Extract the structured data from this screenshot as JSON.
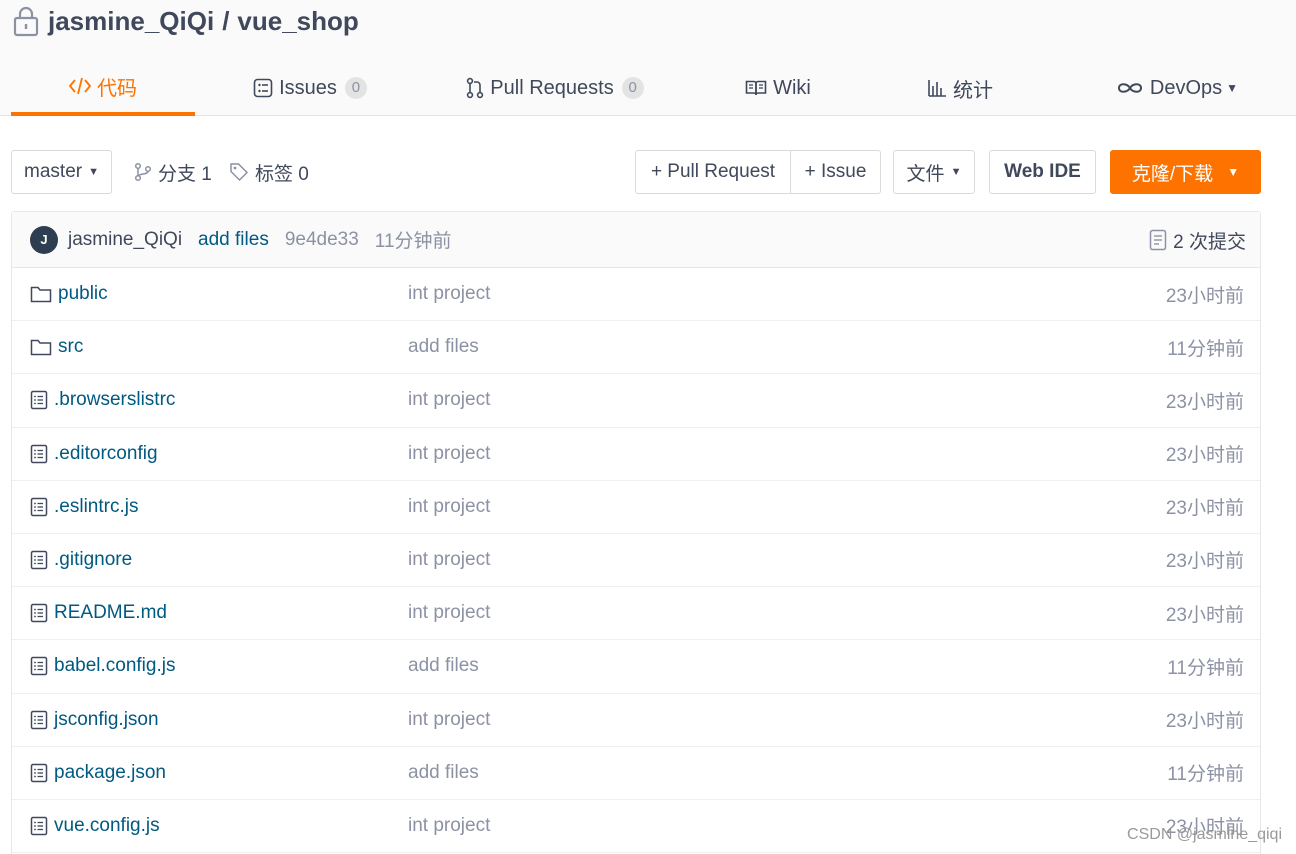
{
  "repo": {
    "owner": "jasmine_QiQi",
    "separator": "/",
    "name": "vue_shop"
  },
  "tabs": [
    {
      "label": "代码",
      "icon": "code-icon",
      "active": true
    },
    {
      "label": "Issues",
      "icon": "issues-icon",
      "count": "0"
    },
    {
      "label": "Pull Requests",
      "icon": "pull-request-icon",
      "count": "0"
    },
    {
      "label": "Wiki",
      "icon": "wiki-icon"
    },
    {
      "label": "统计",
      "icon": "stats-icon"
    },
    {
      "label": "DevOps",
      "icon": "devops-icon",
      "dropdown": true
    }
  ],
  "toolbar": {
    "branch": "master",
    "branches": "分支 1",
    "tags": "标签 0",
    "pull_request": "+ Pull Request",
    "issue": "+ Issue",
    "file": "文件",
    "web_ide": "Web IDE",
    "clone": "克隆/下载"
  },
  "commit": {
    "avatar_letter": "J",
    "author": "jasmine_QiQi",
    "message": "add files",
    "sha": "9e4de33",
    "time": "11分钟前",
    "count_label": "2 次提交"
  },
  "files": [
    {
      "type": "folder",
      "name": "public",
      "message": "int project",
      "time": "23小时前"
    },
    {
      "type": "folder",
      "name": "src",
      "message": "add files",
      "time": "11分钟前"
    },
    {
      "type": "file",
      "name": ".browserslistrc",
      "message": "int project",
      "time": "23小时前"
    },
    {
      "type": "file",
      "name": ".editorconfig",
      "message": "int project",
      "time": "23小时前"
    },
    {
      "type": "file",
      "name": ".eslintrc.js",
      "message": "int project",
      "time": "23小时前"
    },
    {
      "type": "file",
      "name": ".gitignore",
      "message": "int project",
      "time": "23小时前"
    },
    {
      "type": "file",
      "name": "README.md",
      "message": "int project",
      "time": "23小时前"
    },
    {
      "type": "file",
      "name": "babel.config.js",
      "message": "add files",
      "time": "11分钟前"
    },
    {
      "type": "file",
      "name": "jsconfig.json",
      "message": "int project",
      "time": "23小时前"
    },
    {
      "type": "file",
      "name": "package.json",
      "message": "add files",
      "time": "11分钟前"
    },
    {
      "type": "file",
      "name": "vue.config.js",
      "message": "int project",
      "time": "23小时前"
    }
  ],
  "watermark": "CSDN @jasmine_qiqi",
  "colors": {
    "accent": "#fe7300",
    "link": "#005980",
    "muted": "#8c92a4"
  }
}
